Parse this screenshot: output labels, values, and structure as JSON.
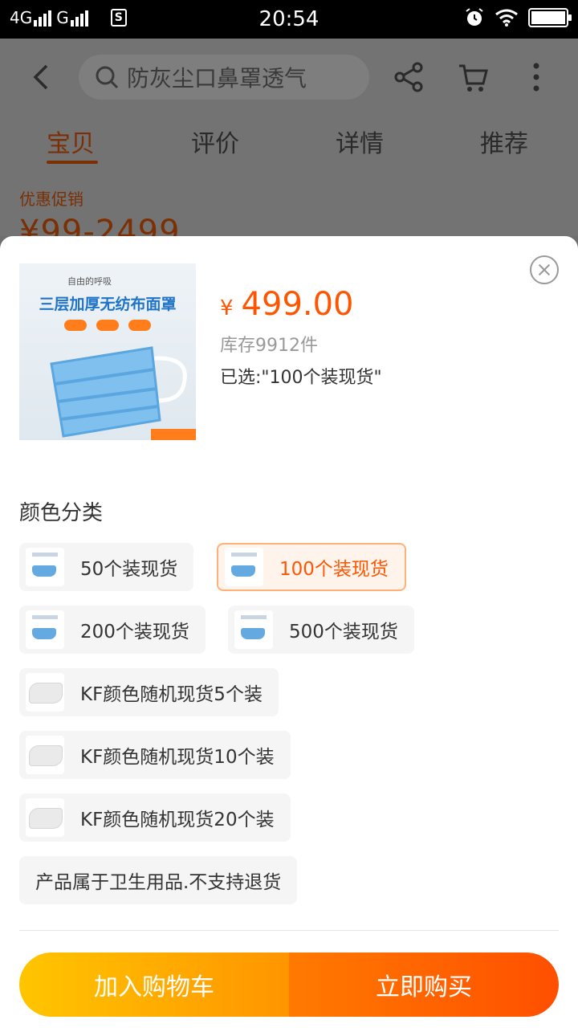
{
  "status_bar": {
    "network_left": "4G",
    "network_right": "G",
    "time": "20:54"
  },
  "nav": {
    "search_placeholder": "防灰尘口鼻罩透气"
  },
  "tabs": [
    {
      "label": "宝贝",
      "active": true
    },
    {
      "label": "评价",
      "active": false
    },
    {
      "label": "详情",
      "active": false
    },
    {
      "label": "推荐",
      "active": false
    }
  ],
  "promo": {
    "label": "优惠促销",
    "price_range": "¥99-2499"
  },
  "product": {
    "thumb_title": "三层加厚无纺布面罩",
    "thumb_subtitle": "自由的呼吸",
    "currency": "¥",
    "price": "499.00",
    "stock": "库存9912件",
    "selected": "已选:\"100个装现货\""
  },
  "options": {
    "title": "颜色分类",
    "items": [
      {
        "label": "50个装现货",
        "icon": "blue-mask-thumb",
        "active": false
      },
      {
        "label": "100个装现货",
        "icon": "blue-mask-thumb",
        "active": true
      },
      {
        "label": "200个装现货",
        "icon": "blue-mask-thumb",
        "active": false
      },
      {
        "label": "500个装现货",
        "icon": "blue-mask-thumb",
        "active": false
      },
      {
        "label": "KF颜色随机现货5个装",
        "icon": "white-kf-mask-thumb",
        "active": false
      },
      {
        "label": "KF颜色随机现货10个装",
        "icon": "white-kf-mask-thumb",
        "active": false
      },
      {
        "label": "KF颜色随机现货20个装",
        "icon": "white-kf-mask-thumb",
        "active": false
      },
      {
        "label": "产品属于卫生用品.不支持退货",
        "icon": "",
        "active": false
      }
    ]
  },
  "actions": {
    "add_to_cart": "加入购物车",
    "buy_now": "立即购买"
  },
  "colors": {
    "accent": "#ff5500",
    "cart_gradient_start": "#ffc500",
    "buy_gradient_end": "#ff4f00"
  }
}
